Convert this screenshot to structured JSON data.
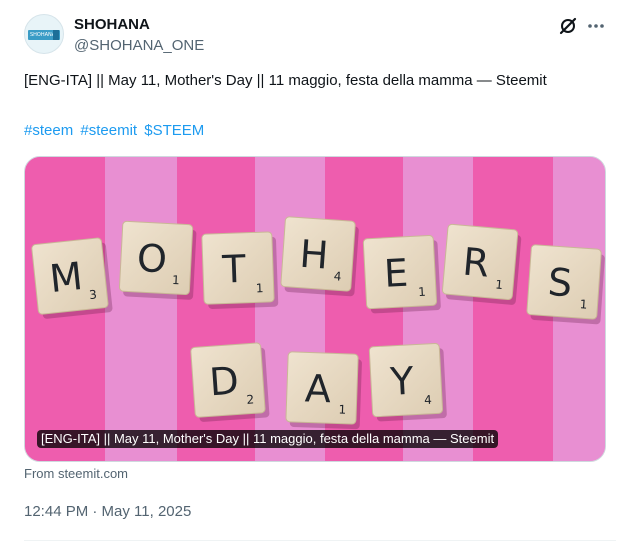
{
  "author": {
    "name": "SHOHANA",
    "handle": "@SHOHANA_ONE",
    "avatar_text": "SHOHANA"
  },
  "tweet": {
    "text": "[ENG-ITA] || May 11, Mother's Day || 11 maggio, festa della mamma — Steemit",
    "hashtags": [
      "#steem",
      "#steemit",
      "$STEEM"
    ]
  },
  "card": {
    "caption": "[ENG-ITA] || May 11, Mother's Day || 11 maggio, festa della mamma — Steemit",
    "source": "From steemit.com",
    "image": {
      "background_colors": [
        "#e879c7",
        "#f05aa8"
      ],
      "tiles_row1": [
        {
          "letter": "M",
          "score": "3"
        },
        {
          "letter": "O",
          "score": "1"
        },
        {
          "letter": "T",
          "score": "1"
        },
        {
          "letter": "H",
          "score": "4"
        },
        {
          "letter": "E",
          "score": "1"
        },
        {
          "letter": "R",
          "score": "1"
        },
        {
          "letter": "S",
          "score": "1"
        }
      ],
      "tiles_row2": [
        {
          "letter": "D",
          "score": "2"
        },
        {
          "letter": "A",
          "score": "1"
        },
        {
          "letter": "Y",
          "score": "4"
        }
      ]
    }
  },
  "timestamp": "12:44 PM · May 11, 2025",
  "icons": {
    "grok": "grok-icon",
    "more": "more-icon"
  },
  "colors": {
    "link": "#1d9bf0",
    "secondary_text": "#536471",
    "primary_text": "#0f1419"
  }
}
